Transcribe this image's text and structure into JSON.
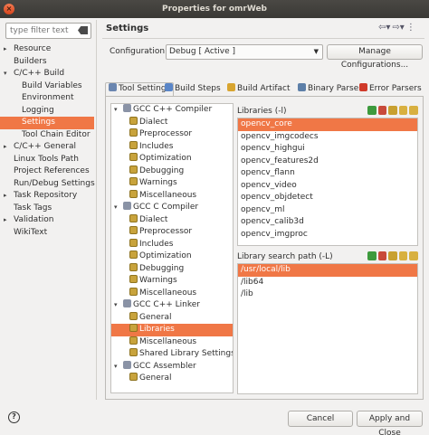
{
  "window": {
    "title": "Properties for omrWeb"
  },
  "filter": {
    "placeholder": "type filter text"
  },
  "nav": [
    {
      "label": "Resource",
      "level": 0,
      "arrow": "▸"
    },
    {
      "label": "Builders",
      "level": 0,
      "arrow": ""
    },
    {
      "label": "C/C++ Build",
      "level": 0,
      "arrow": "▾"
    },
    {
      "label": "Build Variables",
      "level": 1,
      "arrow": ""
    },
    {
      "label": "Environment",
      "level": 1,
      "arrow": ""
    },
    {
      "label": "Logging",
      "level": 1,
      "arrow": ""
    },
    {
      "label": "Settings",
      "level": 1,
      "arrow": "",
      "selected": true
    },
    {
      "label": "Tool Chain Editor",
      "level": 1,
      "arrow": ""
    },
    {
      "label": "C/C++ General",
      "level": 0,
      "arrow": "▸"
    },
    {
      "label": "Linux Tools Path",
      "level": 0,
      "arrow": ""
    },
    {
      "label": "Project References",
      "level": 0,
      "arrow": ""
    },
    {
      "label": "Run/Debug Settings",
      "level": 0,
      "arrow": ""
    },
    {
      "label": "Task Repository",
      "level": 0,
      "arrow": "▸"
    },
    {
      "label": "Task Tags",
      "level": 0,
      "arrow": ""
    },
    {
      "label": "Validation",
      "level": 0,
      "arrow": "▸"
    },
    {
      "label": "WikiText",
      "level": 0,
      "arrow": ""
    }
  ],
  "settings": {
    "title": "Settings",
    "config_label": "Configuration:",
    "config_value": "Debug  [ Active ]",
    "manage_label": "Manage Configurations..."
  },
  "tabs": [
    {
      "label": "Tool Settings",
      "color": "#6b86b0",
      "active": true
    },
    {
      "label": "Build Steps",
      "color": "#5a86c8"
    },
    {
      "label": "Build Artifact",
      "color": "#d8a530"
    },
    {
      "label": "Binary Parsers",
      "color": "#5d7fa8"
    },
    {
      "label": "Error Parsers",
      "color": "#d03a2a"
    }
  ],
  "tree": [
    {
      "label": "GCC C++ Compiler",
      "type": "cat",
      "arrow": "▾"
    },
    {
      "label": "Dialect",
      "type": "leaf"
    },
    {
      "label": "Preprocessor",
      "type": "leaf"
    },
    {
      "label": "Includes",
      "type": "leaf"
    },
    {
      "label": "Optimization",
      "type": "leaf"
    },
    {
      "label": "Debugging",
      "type": "leaf"
    },
    {
      "label": "Warnings",
      "type": "leaf"
    },
    {
      "label": "Miscellaneous",
      "type": "leaf"
    },
    {
      "label": "GCC C Compiler",
      "type": "cat",
      "arrow": "▾"
    },
    {
      "label": "Dialect",
      "type": "leaf"
    },
    {
      "label": "Preprocessor",
      "type": "leaf"
    },
    {
      "label": "Includes",
      "type": "leaf"
    },
    {
      "label": "Optimization",
      "type": "leaf"
    },
    {
      "label": "Debugging",
      "type": "leaf"
    },
    {
      "label": "Warnings",
      "type": "leaf"
    },
    {
      "label": "Miscellaneous",
      "type": "leaf"
    },
    {
      "label": "GCC C++ Linker",
      "type": "cat",
      "arrow": "▾"
    },
    {
      "label": "General",
      "type": "leaf"
    },
    {
      "label": "Libraries",
      "type": "leaf",
      "selected": true
    },
    {
      "label": "Miscellaneous",
      "type": "leaf"
    },
    {
      "label": "Shared Library Settings",
      "type": "leaf"
    },
    {
      "label": "GCC Assembler",
      "type": "cat",
      "arrow": "▾"
    },
    {
      "label": "General",
      "type": "leaf"
    }
  ],
  "libraries": {
    "header": "Libraries (-l)",
    "items": [
      "opencv_core",
      "opencv_imgcodecs",
      "opencv_highgui",
      "opencv_features2d",
      "opencv_flann",
      "opencv_video",
      "opencv_objdetect",
      "opencv_ml",
      "opencv_calib3d",
      "opencv_imgproc"
    ]
  },
  "search_paths": {
    "header": "Library search path (-L)",
    "items": [
      "/usr/local/lib",
      "/lib64",
      "/lib"
    ]
  },
  "tool_icons": [
    "add-icon",
    "delete-icon",
    "edit-icon",
    "move-up-icon",
    "move-down-icon"
  ],
  "tool_icon_colors": [
    "#3d9a3d",
    "#c84a3a",
    "#c8a030",
    "#d8b040",
    "#d8b040"
  ],
  "footer": {
    "cancel_label": "Cancel",
    "apply_label": "Apply and Close"
  }
}
